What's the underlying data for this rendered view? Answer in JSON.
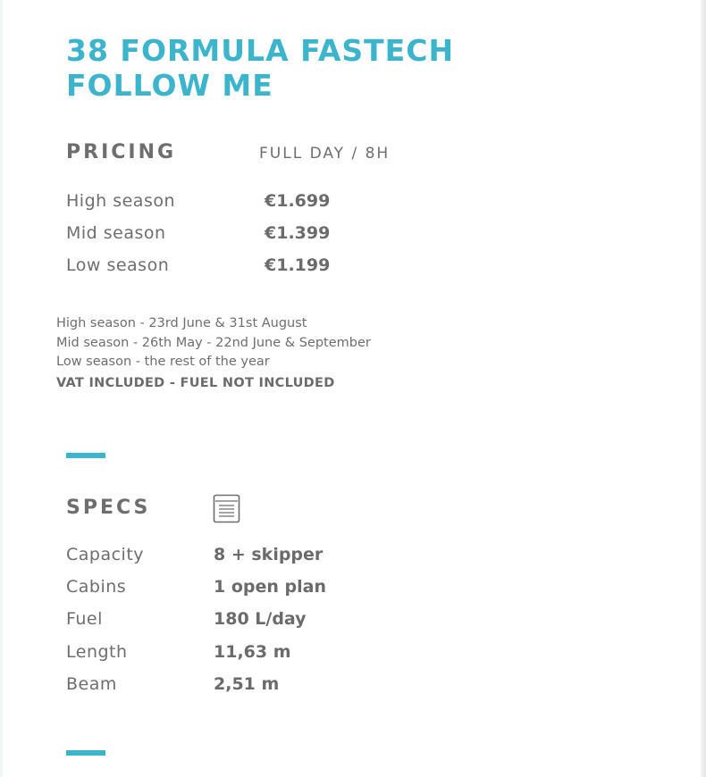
{
  "title": {
    "line1": "38 FORMULA FASTECH",
    "line2": "FOLLOW ME"
  },
  "pricing": {
    "heading": "PRICING",
    "subheading": "FULL DAY / 8H",
    "rows": [
      {
        "label": "High season",
        "value": "€1.699"
      },
      {
        "label": "Mid season",
        "value": "€1.399"
      },
      {
        "label": "Low season",
        "value": "€1.199"
      }
    ]
  },
  "notes": {
    "lines": [
      "High season - 23rd June & 31st August",
      "Mid season - 26th May - 22nd June & September",
      "Low season - the rest of the year"
    ],
    "vat": "VAT INCLUDED - FUEL NOT INCLUDED"
  },
  "specs": {
    "heading": "SPECS",
    "icon": "document-icon",
    "rows": [
      {
        "label": "Capacity",
        "value": "8 + skipper"
      },
      {
        "label": "Cabins",
        "value": "1 open plan"
      },
      {
        "label": "Fuel",
        "value": "180 L/day"
      },
      {
        "label": "Length",
        "value": "11,63 m"
      },
      {
        "label": "Beam",
        "value": "2,51 m"
      }
    ]
  },
  "colors": {
    "accent": "#3bb4cc",
    "text": "#6e6e6e"
  }
}
